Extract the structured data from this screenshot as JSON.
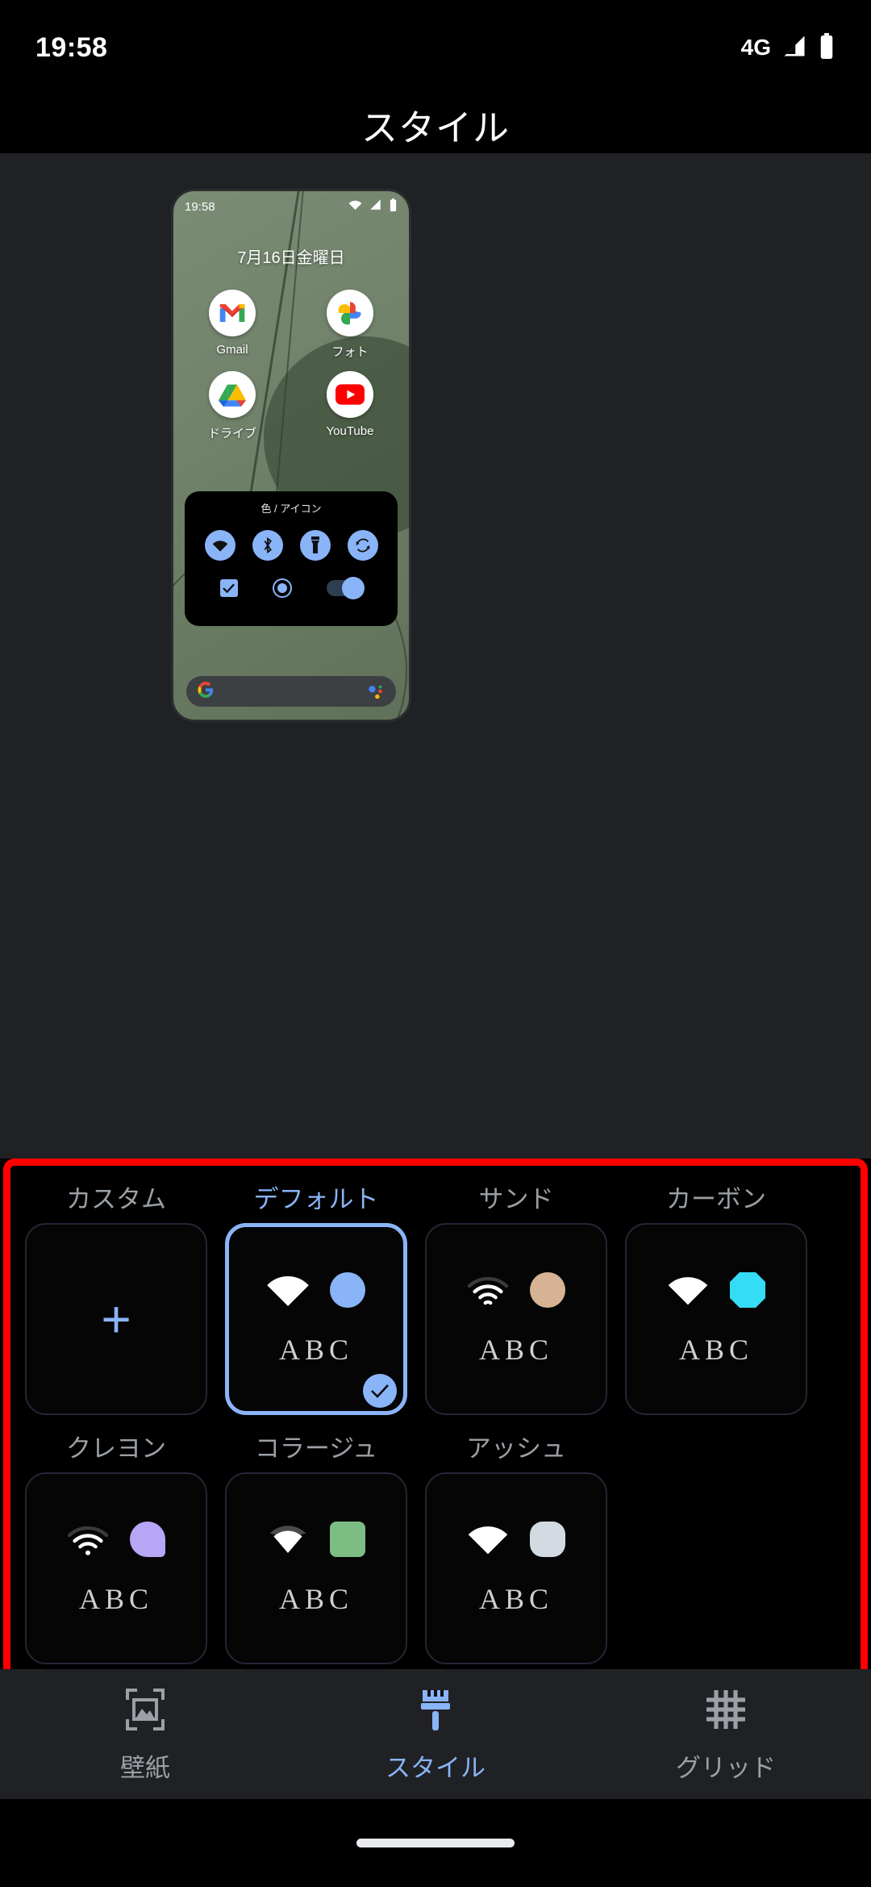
{
  "status_bar": {
    "time": "19:58",
    "network_label": "4G",
    "icons": [
      "signal-icon",
      "battery-icon"
    ]
  },
  "header": {
    "title": "スタイル"
  },
  "preview": {
    "phone_status": {
      "time": "19:58",
      "icons": [
        "wifi-icon",
        "signal-icon",
        "battery-icon"
      ]
    },
    "date": "7月16日金曜日",
    "apps": [
      {
        "label": "Gmail",
        "icon": "gmail-icon"
      },
      {
        "label": "フォト",
        "icon": "google-photos-icon"
      },
      {
        "label": "ドライブ",
        "icon": "google-drive-icon"
      },
      {
        "label": "YouTube",
        "icon": "youtube-icon"
      }
    ],
    "quick_settings": {
      "title": "色 / アイコン",
      "toggles": [
        "wifi-icon",
        "bluetooth-icon",
        "flashlight-icon",
        "auto-rotate-icon"
      ],
      "controls": [
        "checkbox-checked",
        "radio-selected",
        "switch-on"
      ]
    },
    "search": {
      "logo": "google-g-icon",
      "assistant": "google-assistant-icon"
    }
  },
  "style_picker": {
    "highlight_color": "#ff0000",
    "accent_color": "#8ab4f8",
    "sample_text": "ABC",
    "rows": [
      [
        {
          "name": "カスタム",
          "type": "add",
          "plus": "+",
          "selected": false
        },
        {
          "name": "デフォルト",
          "type": "style",
          "selected": true,
          "shape": "circle",
          "color": "#8ab4f8",
          "wifi": "filled",
          "wifi_color": "#ffffff"
        },
        {
          "name": "サンド",
          "type": "style",
          "selected": false,
          "shape": "circle",
          "color": "#d6b394",
          "wifi": "arcs",
          "wifi_color": "#ffffff"
        },
        {
          "name": "カーボン",
          "type": "style",
          "selected": false,
          "shape": "octagon",
          "color": "#35dcf5",
          "wifi": "filled",
          "wifi_color": "#ffffff"
        }
      ],
      [
        {
          "name": "クレヨン",
          "type": "style",
          "selected": false,
          "shape": "teardrop",
          "color": "#b7a5f5",
          "wifi": "arcs",
          "wifi_color": "#ffffff"
        },
        {
          "name": "コラージュ",
          "type": "style",
          "selected": false,
          "shape": "rounded-square",
          "color": "#7cbd84",
          "wifi": "filled",
          "wifi_color": "#ffffff"
        },
        {
          "name": "アッシュ",
          "type": "style",
          "selected": false,
          "shape": "squircle",
          "color": "#d4dae1",
          "wifi": "filled",
          "wifi_color": "#ffffff"
        }
      ]
    ]
  },
  "bottom_nav": {
    "items": [
      {
        "label": "壁紙",
        "icon": "wallpaper-icon",
        "active": false
      },
      {
        "label": "スタイル",
        "icon": "brush-icon",
        "active": true
      },
      {
        "label": "グリッド",
        "icon": "grid-icon",
        "active": false
      }
    ]
  }
}
